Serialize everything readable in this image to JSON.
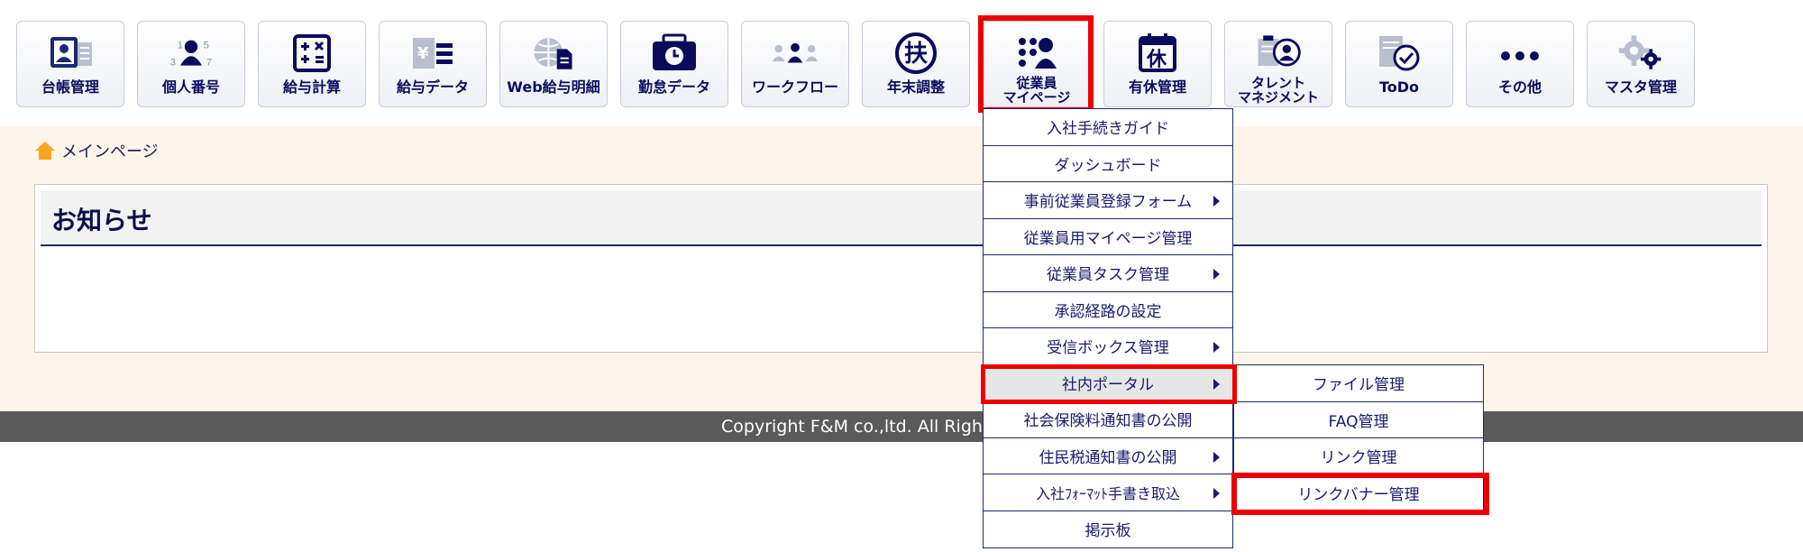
{
  "toolbar": {
    "items": [
      {
        "label": "台帳管理",
        "icon": "ledger-icon"
      },
      {
        "label": "個人番号",
        "icon": "person-number-icon"
      },
      {
        "label": "給与計算",
        "icon": "calculator-icon"
      },
      {
        "label": "給与データ",
        "icon": "salary-data-icon"
      },
      {
        "label": "Web給与明細",
        "icon": "web-payslip-icon"
      },
      {
        "label": "勤怠データ",
        "icon": "attendance-icon"
      },
      {
        "label": "ワークフロー",
        "icon": "workflow-icon"
      },
      {
        "label": "年末調整",
        "icon": "year-end-adjustment-icon"
      },
      {
        "label": "従業員\nマイページ",
        "icon": "employee-mypage-icon"
      },
      {
        "label": "有休管理",
        "icon": "paid-leave-icon"
      },
      {
        "label": "タレント\nマネジメント",
        "icon": "talent-management-icon"
      },
      {
        "label": "ToDo",
        "icon": "todo-icon"
      },
      {
        "label": "その他",
        "icon": "more-icon"
      },
      {
        "label": "マスタ管理",
        "icon": "master-settings-icon"
      }
    ],
    "yearend_glyph": "扶",
    "leave_glyph": "休",
    "salary_glyph": "¥",
    "number_digits": [
      "1",
      "5",
      "3",
      "7"
    ]
  },
  "breadcrumb": {
    "home_label": "メインページ"
  },
  "notice": {
    "title": "お知らせ"
  },
  "footer": {
    "copyright": "Copyright F&M co.,ltd. All Rights Reserved."
  },
  "menu": {
    "items": [
      {
        "label": "入社手続きガイド"
      },
      {
        "label": "ダッシュボード"
      },
      {
        "label": "事前従業員登録フォーム"
      },
      {
        "label": "従業員用マイページ管理"
      },
      {
        "label": "従業員タスク管理"
      },
      {
        "label": "承認経路の設定"
      },
      {
        "label": "受信ボックス管理"
      },
      {
        "label": "社内ポータル"
      },
      {
        "label": "社会保険料通知書の公開"
      },
      {
        "label": "住民税通知書の公開"
      },
      {
        "label": "入社ﾌｫｰﾏｯﾄ手書き取込"
      },
      {
        "label": "掲示板"
      }
    ]
  },
  "submenu": {
    "items": [
      {
        "label": "ファイル管理"
      },
      {
        "label": "FAQ管理"
      },
      {
        "label": "リンク管理"
      },
      {
        "label": "リンクバナー管理"
      }
    ]
  },
  "colors": {
    "highlight": "#ee0000",
    "navy": "#1d2a6d",
    "footer": "#5a5a5a",
    "page_bg": "#fdf5ea"
  }
}
